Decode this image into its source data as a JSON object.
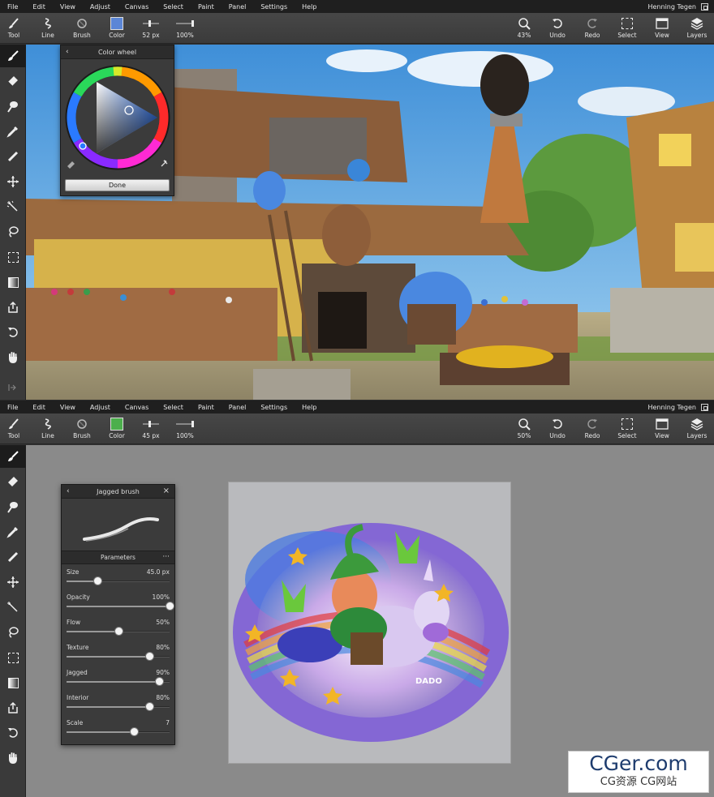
{
  "window_top": {
    "menu": [
      "File",
      "Edit",
      "View",
      "Adjust",
      "Canvas",
      "Select",
      "Paint",
      "Panel",
      "Settings",
      "Help"
    ],
    "user": "Henning Tegen",
    "toolbar": {
      "tool": "Tool",
      "line": "Line",
      "brush": "Brush",
      "color": "Color",
      "size": "52 px",
      "opacity": "100%",
      "zoom": "43%",
      "undo": "Undo",
      "redo": "Redo",
      "select": "Select",
      "view": "View",
      "layers": "Layers"
    },
    "current_color": "#5b86d6",
    "color_wheel": {
      "title": "Color wheel",
      "done_label": "Done"
    }
  },
  "window_bottom": {
    "menu": [
      "File",
      "Edit",
      "View",
      "Adjust",
      "Canvas",
      "Select",
      "Paint",
      "Panel",
      "Settings",
      "Help"
    ],
    "user": "Henning Tegen",
    "toolbar": {
      "tool": "Tool",
      "line": "Line",
      "brush": "Brush",
      "color": "Color",
      "size": "45 px",
      "opacity": "100%",
      "zoom": "50%",
      "undo": "Undo",
      "redo": "Redo",
      "select": "Select",
      "view": "View",
      "layers": "Layers"
    },
    "current_color": "#4caf4c",
    "brush_panel": {
      "title": "Jagged brush",
      "section": "Parameters",
      "params": [
        {
          "label": "Size",
          "value": "45.0 px",
          "level": 0.3
        },
        {
          "label": "Opacity",
          "value": "100%",
          "level": 1.0
        },
        {
          "label": "Flow",
          "value": "50%",
          "level": 0.5
        },
        {
          "label": "Texture",
          "value": "80%",
          "level": 0.8
        },
        {
          "label": "Jagged",
          "value": "90%",
          "level": 0.9
        },
        {
          "label": "Interior",
          "value": "80%",
          "level": 0.8
        },
        {
          "label": "Scale",
          "value": "7",
          "level": 0.65
        }
      ]
    },
    "artwork_signature": "DADO"
  },
  "watermark": {
    "line1": "CGer.com",
    "line2": "CG资源 CG网站"
  },
  "icons": [
    "brush-icon",
    "eraser-icon",
    "smudge-icon",
    "eyedropper-icon",
    "ruler-icon",
    "move-icon",
    "magic-wand-icon",
    "lasso-icon",
    "marquee-icon",
    "gradient-icon",
    "share-icon",
    "rotate-icon",
    "hand-icon",
    "expand-icon",
    "zoom-icon",
    "undo-icon",
    "redo-icon",
    "select-icon",
    "view-icon",
    "layers-icon"
  ]
}
